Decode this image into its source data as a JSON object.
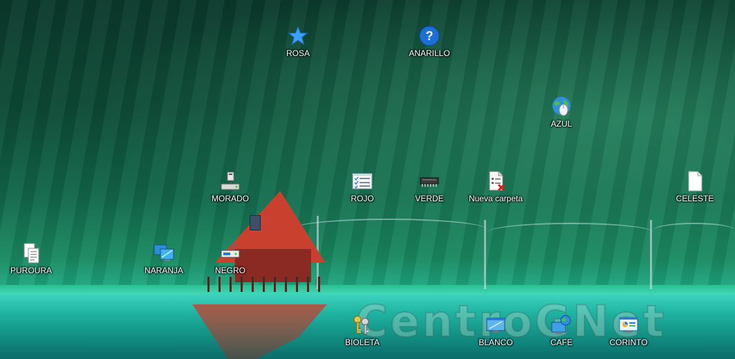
{
  "desktop": {
    "watermark": "CentroGNet",
    "icons": [
      {
        "label": "ROSA",
        "icon": "star-icon"
      },
      {
        "label": "ANARILLO",
        "icon": "help-question-icon"
      },
      {
        "label": "AZUL",
        "icon": "globe-mouse-icon"
      },
      {
        "label": "MORADO",
        "icon": "network-drive-icon"
      },
      {
        "label": "ROJO",
        "icon": "checklist-window-icon"
      },
      {
        "label": "VERDE",
        "icon": "memory-chip-icon"
      },
      {
        "label": "Nueva carpeta",
        "icon": "document-error-icon"
      },
      {
        "label": "CELESTE",
        "icon": "blank-file-icon"
      },
      {
        "label": "PUROURA",
        "icon": "multiple-documents-icon"
      },
      {
        "label": "NARANJA",
        "icon": "monitors-icon"
      },
      {
        "label": "NEGRO",
        "icon": "network-adapter-icon"
      },
      {
        "label": "BIOLETA",
        "icon": "keys-icon"
      },
      {
        "label": "BLANCO",
        "icon": "window-monitor-icon"
      },
      {
        "label": "CAFE",
        "icon": "computer-globe-icon"
      },
      {
        "label": "CORINTO",
        "icon": "control-panel-icon"
      }
    ]
  }
}
